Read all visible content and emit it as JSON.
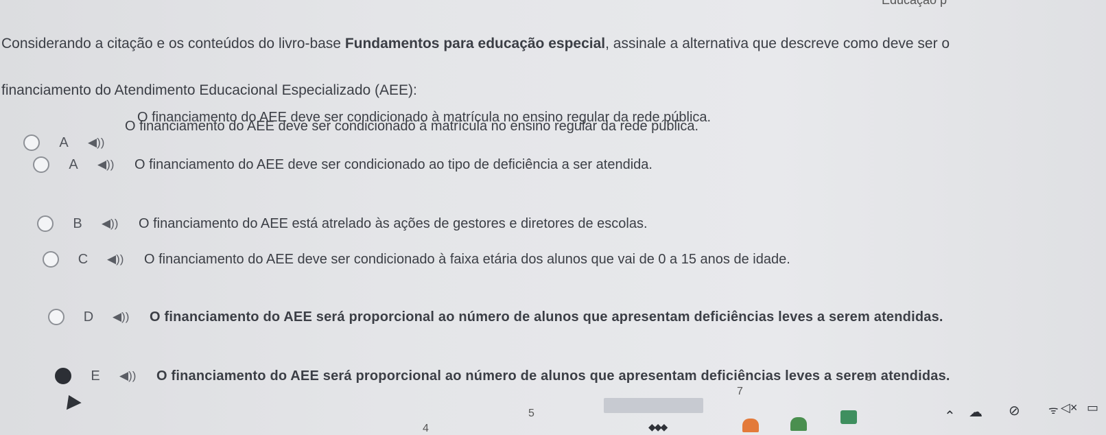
{
  "header_fragment": "Educação p",
  "question": {
    "line1_pre": "Considerando a citação e os conteúdos do livro-base ",
    "line1_bold": "Fundamentos para educação especial",
    "line1_post": ", assinale a alternativa que descreve como deve ser o",
    "line2": "financiamento do Atendimento Educacional Especializado (AEE):"
  },
  "prelude_text": "",
  "options": [
    {
      "letter": "A",
      "text": "O financiamento do AEE  deve ser condicionado à matrícula no ensino regular da rede pública.",
      "selected": false,
      "bold": false
    },
    {
      "letter": "B",
      "text": "O financiamento do AEE  deve ser condicionado ao tipo de deficiência a ser atendida.",
      "selected": false,
      "bold": false
    },
    {
      "letter": "C",
      "text": "O financiamento do AEE está atrelado às ações de gestores e diretores de escolas.",
      "selected": false,
      "bold": false
    },
    {
      "letter": "D",
      "text": "O financiamento do AEE deve ser condicionado à faixa etária dos alunos que vai de 0 a 15 anos de idade.",
      "selected": false,
      "bold": false
    },
    {
      "letter": "E",
      "text": "O financiamento do AEE será proporcional ao número de alunos que apresentam deficiências leves a serem atendidas.",
      "selected": true,
      "bold": true
    }
  ],
  "speaker_icon": "speaker-icon",
  "taskbar": {
    "fragments": [
      "7",
      "8",
      "5",
      "4"
    ],
    "icons": [
      "chevron-up-icon",
      "cloud-icon",
      "no-signal-icon",
      "wifi-icon",
      "volume-muted-icon",
      "battery-icon"
    ],
    "mute_label": "◁×"
  }
}
